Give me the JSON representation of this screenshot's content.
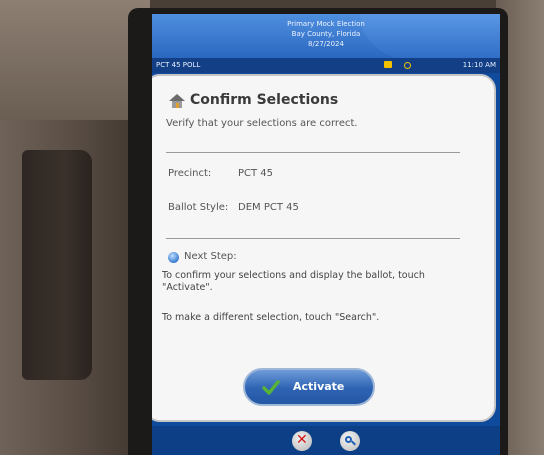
{
  "header": {
    "election_name": "Primary Mock Election",
    "county": "Bay County, Florida",
    "date": "8/27/2024"
  },
  "status_bar": {
    "poll_name": "PCT 45 POLL",
    "time": "11:10 AM"
  },
  "dialog": {
    "title": "Confirm Selections",
    "subtitle": "Verify that your selections are correct.",
    "precinct_label": "Precinct:",
    "precinct_value": "PCT 45",
    "ballot_style_label": "Ballot Style:",
    "ballot_style_value": "DEM PCT 45",
    "next_step_label": "Next Step:",
    "instruction_activate": "To confirm your selections and display the ballot, touch \"Activate\".",
    "instruction_search": "To make a different selection, touch \"Search\"."
  },
  "buttons": {
    "activate_label": "Activate"
  },
  "colors": {
    "screen_blue": "#0f4a9c",
    "accent_green": "#57b33a",
    "cancel_red": "#d01515"
  },
  "icons": [
    "house-icon",
    "info-icon",
    "checkmark-icon",
    "cancel-icon",
    "search-icon",
    "document-icon",
    "settings-icon"
  ]
}
